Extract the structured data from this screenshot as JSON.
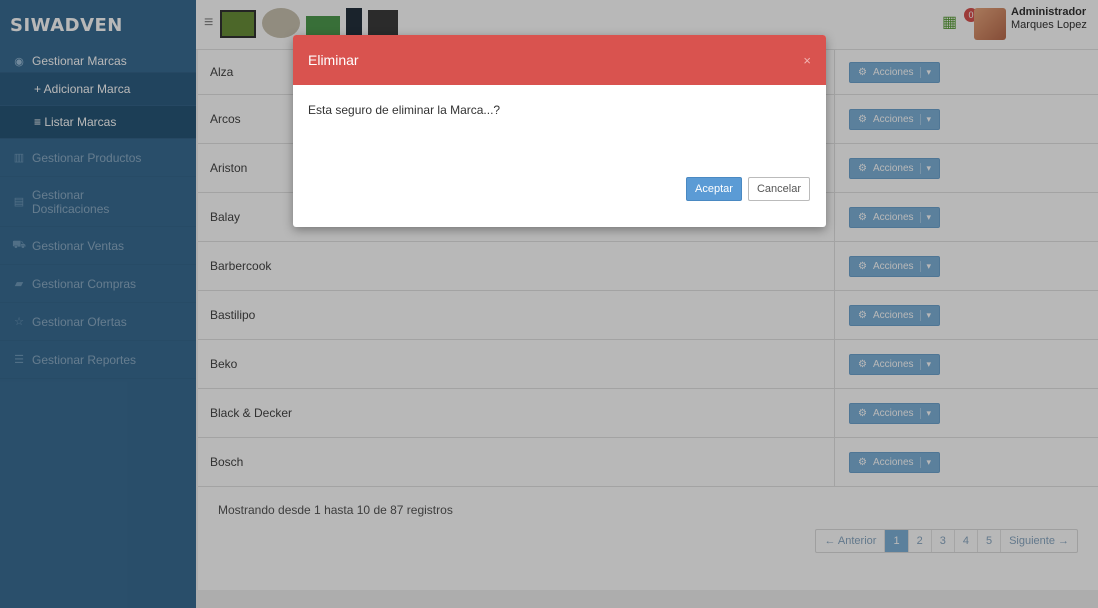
{
  "brand": "SIWADVEN",
  "sidebar": {
    "items": [
      {
        "icon": "circle-icon",
        "label": "Gestionar Marcas"
      },
      {
        "icon": "plus-icon",
        "label": "+ Adicionar Marca"
      },
      {
        "icon": "list-icon",
        "label": "≡ Listar Marcas"
      },
      {
        "icon": "box-icon",
        "label": "Gestionar Productos"
      },
      {
        "icon": "doc-icon",
        "label": "Gestionar Dosificaciones"
      },
      {
        "icon": "cart-icon",
        "label": "Gestionar Ventas"
      },
      {
        "icon": "book-icon",
        "label": "Gestionar Compras"
      },
      {
        "icon": "star-icon",
        "label": "Gestionar Ofertas"
      },
      {
        "icon": "report-icon",
        "label": "Gestionar Reportes"
      }
    ]
  },
  "header": {
    "notif_count": "0",
    "user_role": "Administrador",
    "user_name": "Marques Lopez"
  },
  "table": {
    "rows": [
      "Alza",
      "Arcos",
      "Ariston",
      "Balay",
      "Barbercook",
      "Bastilipo",
      "Beko",
      "Black & Decker",
      "Bosch"
    ],
    "action_label": "Acciones"
  },
  "footer": {
    "info": "Mostrando desde 1 hasta 10 de 87 registros",
    "pager": [
      "← Anterior",
      "1",
      "2",
      "3",
      "4",
      "5",
      "Siguiente →"
    ]
  },
  "modal": {
    "title": "Eliminar",
    "close": "×",
    "message": "Esta seguro de eliminar la Marca...?",
    "ok_label": "Aceptar",
    "cancel_label": "Cancelar"
  },
  "colors": {
    "sidebar": "#3a6d94",
    "modal_header": "#d9534f",
    "accent": "#7fb2d9"
  }
}
